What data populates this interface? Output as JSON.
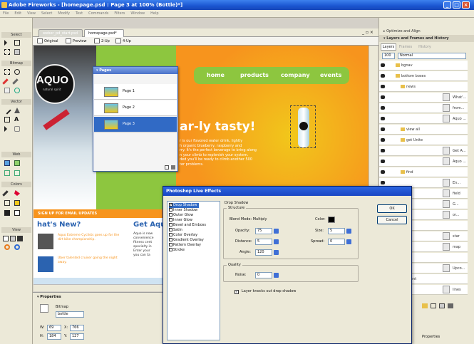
{
  "window": {
    "title": "Adobe Fireworks - [homepage.psd : Page 3 at 100% (Bottle)*]",
    "min": "_",
    "max": "□",
    "close": "×"
  },
  "menu": [
    "File",
    "Edit",
    "View",
    "Select",
    "Modify",
    "Text",
    "Commands",
    "Filters",
    "Window",
    "Help"
  ],
  "tools": {
    "select": "Select",
    "bitmap": "Bitmap",
    "vector": "Vector",
    "web": "Web",
    "colors": "Colors",
    "view": "View"
  },
  "doc": {
    "tabs": [
      "weber_pd_start.psd",
      "homepage.psd*"
    ],
    "views": [
      "Original",
      "Preview",
      "2-Up",
      "4-Up"
    ]
  },
  "site": {
    "logo": "AQUO",
    "logo_sub": "natural spirit",
    "nav": [
      "home",
      "products",
      "company",
      "events"
    ],
    "headline": "ar-ly tasty!",
    "body": "r is our flavored water drink, lightly<br>h organic blueberry, raspberry and<br>rry. It's the perfect beverage to bring along<br>n your climb to replenish your system.<br>ded you'll be ready to climb another 500<br>ter problems.",
    "signup": "SIGN UP FOR EMAIL UPDATES",
    "whats_new": "hat's New?",
    "get_aquo": "Get Aqu",
    "news1": "Aquo Extreme Cyclists goes up for the dirt bike championship.",
    "news2": "Uber talented cruiser going the night away.",
    "getaquo_text": "Aquo is now\nconvenience\nfitness cent\nspecialty in\nEnter your\nyou can ta"
  },
  "pages_panel": {
    "title": "▾ Pages",
    "pages": [
      "Page 1",
      "Page 2",
      "Page 3"
    ]
  },
  "right_panel": {
    "optimize": "▸ Optimize and Align",
    "layers_title": "▾ Layers and Frames and History",
    "tabs": [
      "Layers",
      "Frames",
      "History"
    ],
    "opacity": "100",
    "blend": "Normal",
    "layers": [
      "Normal",
      "bgnav",
      "bottom boxes",
      "news",
      "What'...",
      "from...",
      "Aquo ...",
      "view all",
      "get Unite",
      "Get A...",
      "Aquo ...",
      "find",
      "En...",
      "field",
      "G...",
      "or...",
      "stars",
      "star",
      "map",
      "Bottle",
      "Upco...",
      "event",
      "lines"
    ],
    "bottom_label": "Properties"
  },
  "dialog": {
    "title": "Photoshop Live Effects",
    "effects": [
      "Drop Shadow",
      "Inner Shadow",
      "Outer Glow",
      "Inner Glow",
      "Bevel and Emboss",
      "Satin",
      "Color Overlay",
      "Gradient Overlay",
      "Pattern Overlay",
      "Stroke"
    ],
    "effect_checked": [
      true,
      false,
      false,
      false,
      false,
      false,
      false,
      false,
      false,
      false
    ],
    "section": "Drop Shadow",
    "structure": "Structure",
    "blend_mode": "Blend Mode: Multiply",
    "color_label": "Color:",
    "opacity_label": "Opacity:",
    "opacity": "75",
    "distance_label": "Distance:",
    "distance": "5",
    "angle_label": "Angle:",
    "angle": "120",
    "size_label": "Size:",
    "size": "5",
    "spread_label": "Spread:",
    "spread": "0",
    "quality": "Quality",
    "noise_label": "Noise:",
    "noise": "0",
    "knockout": "Layer knocks out drop shadow",
    "ok": "OK",
    "cancel": "Cancel"
  },
  "properties": {
    "title": "▾ Properties",
    "type": "Bitmap",
    "name": "bottle",
    "w": "69",
    "x": "766",
    "h": "184",
    "y": "127"
  },
  "colors": {
    "accent": "#316ac5",
    "green": "#8dc63f",
    "orange": "#f7941d",
    "yellow": "#f1c71b",
    "sky": "#67c2e6"
  }
}
